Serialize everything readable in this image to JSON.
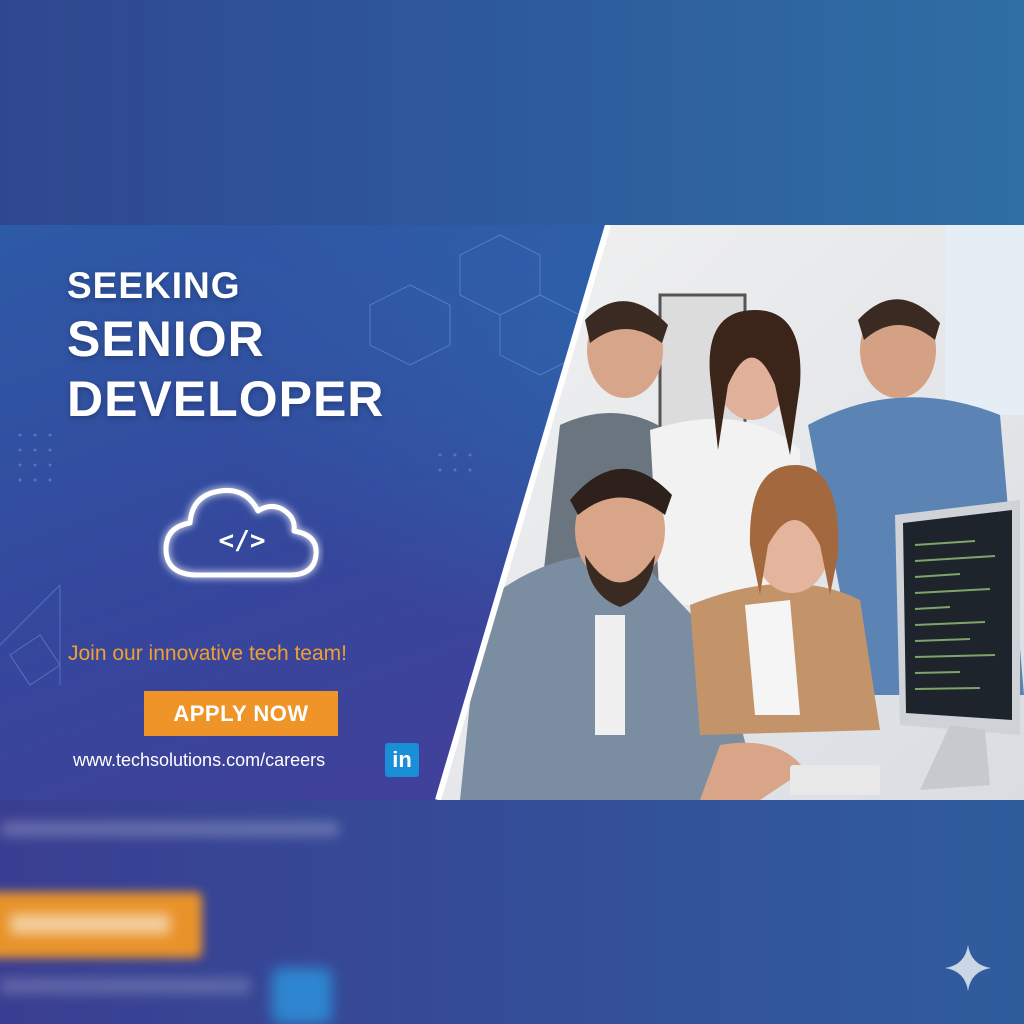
{
  "banner": {
    "headline_small": "SEEKING",
    "headline_line1": "SENIOR",
    "headline_line2": "DEVELOPER",
    "code_symbol": "</>",
    "tagline": "Join our innovative tech team!",
    "apply_label": "APPLY NOW",
    "url": "www.techsolutions.com/careers",
    "social_badge": "in"
  },
  "icons": [
    "cloud-code-icon",
    "linkedin-icon",
    "sparkle-icon"
  ],
  "colors": {
    "accent_orange": "#ee9428",
    "tagline_orange": "#f0a030",
    "linkedin_blue": "#1a8ed6",
    "bg_blue": "#2d5aa6",
    "bg_purple": "#4a3b98"
  }
}
